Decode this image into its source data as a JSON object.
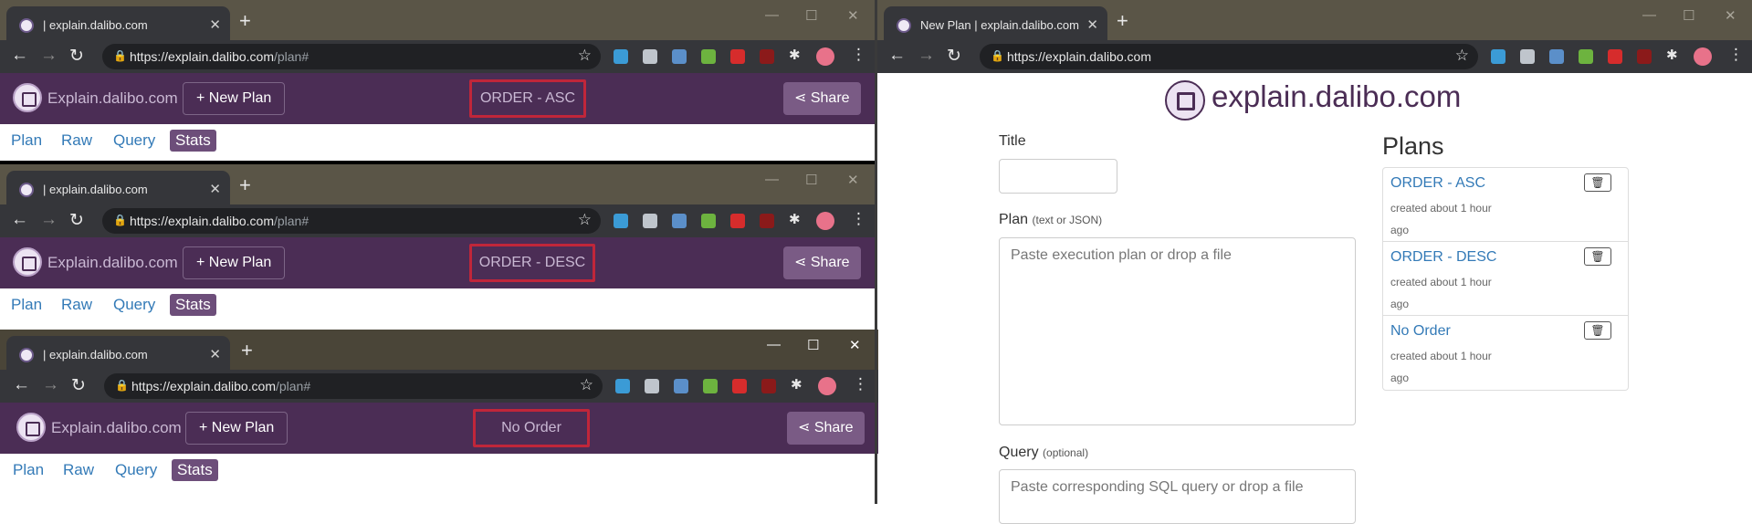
{
  "windows": [
    {
      "tab_title": "| explain.dalibo.com",
      "url_host": "https://explain.dalibo.com",
      "url_path": "/plan#",
      "brand": "Explain.dalibo.com",
      "new_plan": "+ New Plan",
      "plan_title": "ORDER - ASC",
      "share": "Share",
      "subnav": [
        "Plan",
        "Raw",
        "Query",
        "Stats"
      ]
    },
    {
      "tab_title": "| explain.dalibo.com",
      "url_host": "https://explain.dalibo.com",
      "url_path": "/plan#",
      "brand": "Explain.dalibo.com",
      "new_plan": "+ New Plan",
      "plan_title": "ORDER - DESC",
      "share": "Share",
      "subnav": [
        "Plan",
        "Raw",
        "Query",
        "Stats"
      ]
    },
    {
      "tab_title": "| explain.dalibo.com",
      "url_host": "https://explain.dalibo.com",
      "url_path": "/plan#",
      "brand": "Explain.dalibo.com",
      "new_plan": "+ New Plan",
      "plan_title": "No Order",
      "share": "Share",
      "subnav": [
        "Plan",
        "Raw",
        "Query",
        "Stats"
      ]
    }
  ],
  "right": {
    "tab_title": "New Plan | explain.dalibo.com",
    "url": "https://explain.dalibo.com",
    "site_title": "explain.dalibo.com",
    "title_label": "Title",
    "plan_label": "Plan",
    "plan_hint": "(text or JSON)",
    "plan_placeholder": "Paste execution plan or drop a file",
    "query_label": "Query",
    "query_hint": "(optional)",
    "query_placeholder": "Paste corresponding SQL query or drop a file",
    "plans_heading": "Plans",
    "plans": [
      {
        "name": "ORDER - ASC",
        "created": "created about 1 hour ago"
      },
      {
        "name": "ORDER - DESC",
        "created": "created about 1 hour ago"
      },
      {
        "name": "No Order",
        "created": "created about 1 hour ago"
      }
    ]
  },
  "colors": {
    "app_nav": "#4b2d55",
    "active_tab": "#6d4e7a",
    "link": "#337ab7",
    "highlight_box": "#c0263a"
  }
}
